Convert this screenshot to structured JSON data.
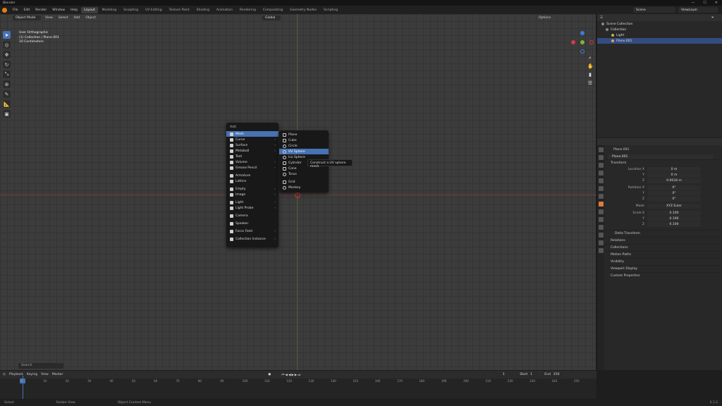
{
  "window": {
    "title": "Blender",
    "controls": [
      "—",
      "☐",
      "✕"
    ]
  },
  "topbar": {
    "menus": [
      "File",
      "Edit",
      "Render",
      "Window",
      "Help"
    ],
    "workspaces": [
      "Layout",
      "Modeling",
      "Sculpting",
      "UV Editing",
      "Texture Paint",
      "Shading",
      "Animation",
      "Rendering",
      "Compositing",
      "Geometry Nodes",
      "Scripting"
    ],
    "active_workspace": "Layout",
    "scene": "Scene",
    "view_layer": "ViewLayer"
  },
  "viewport_header": {
    "mode": "Object Mode",
    "menus": [
      "View",
      "Select",
      "Add",
      "Object"
    ],
    "transform_orientation": "Global",
    "options": "Options"
  },
  "viewport_info": {
    "line1": "User Orthographic",
    "line2": "(1) Collection | Plane.001",
    "line3": "10 Centimeters"
  },
  "add_menu": {
    "title": "Add",
    "items": [
      {
        "label": "Mesh",
        "has_sub": true
      },
      {
        "label": "Curve",
        "has_sub": true
      },
      {
        "label": "Surface",
        "has_sub": true
      },
      {
        "label": "Metaball",
        "has_sub": true
      },
      {
        "label": "Text",
        "has_sub": false
      },
      {
        "label": "Volume",
        "has_sub": true
      },
      {
        "label": "Grease Pencil",
        "has_sub": true
      },
      {
        "label": "Armature",
        "has_sub": false
      },
      {
        "label": "Lattice",
        "has_sub": false
      },
      {
        "label": "Empty",
        "has_sub": true
      },
      {
        "label": "Image",
        "has_sub": true
      },
      {
        "label": "Light",
        "has_sub": true
      },
      {
        "label": "Light Probe",
        "has_sub": true
      },
      {
        "label": "Camera",
        "has_sub": false
      },
      {
        "label": "Speaker",
        "has_sub": false
      },
      {
        "label": "Force Field",
        "has_sub": true
      },
      {
        "label": "Collection Instance",
        "has_sub": true
      }
    ]
  },
  "mesh_submenu": {
    "items": [
      "Plane",
      "Cube",
      "Circle",
      "UV Sphere",
      "Ico Sphere",
      "Cylinder",
      "Cone",
      "Torus",
      "Grid",
      "Monkey"
    ],
    "highlighted": "UV Sphere"
  },
  "tooltip": "Construct a UV sphere mesh.",
  "viewport_search": "Search",
  "outliner": {
    "root": "Scene Collection",
    "collection": "Collection",
    "objects": [
      "Light",
      "Plane.001"
    ],
    "selected": "Plane.001"
  },
  "properties": {
    "object_name": "Plane.001",
    "object_field": "Plane.001",
    "transform_label": "Transform",
    "location": {
      "label": "Location X",
      "x": "0 m",
      "y": "0 m",
      "z": "0.0034 m"
    },
    "rotation": {
      "label": "Rotation X",
      "x": "0°",
      "y": "0°",
      "z": "0°"
    },
    "mode": {
      "label": "Mode",
      "value": "XYZ Euler"
    },
    "scale": {
      "label": "Scale X",
      "x": "0.100",
      "y": "0.100",
      "z": "0.100"
    },
    "axis_labels": [
      "Y",
      "Z"
    ],
    "panels": [
      "Delta Transform",
      "Relations",
      "Collections",
      "Motion Paths",
      "Visibility",
      "Viewport Display",
      "Custom Properties"
    ]
  },
  "timeline": {
    "menus": [
      "Playback",
      "Keying",
      "View",
      "Marker"
    ],
    "current_frame": "1",
    "start_label": "Start",
    "start": "1",
    "end_label": "End",
    "end": "250",
    "ticks": [
      "0",
      "10",
      "20",
      "30",
      "40",
      "50",
      "60",
      "70",
      "80",
      "90",
      "100",
      "110",
      "120",
      "130",
      "140",
      "150",
      "160",
      "170",
      "180",
      "190",
      "200",
      "210",
      "220",
      "230",
      "240",
      "250"
    ]
  },
  "statusbar": {
    "items": [
      "Select",
      "Rotate View",
      "Object Context Menu"
    ],
    "version": "3.1.2"
  },
  "colors": {
    "accent": "#4772b3",
    "background": "#3c3c3c",
    "menu_bg": "#181818",
    "logo": "#e87d0d"
  }
}
